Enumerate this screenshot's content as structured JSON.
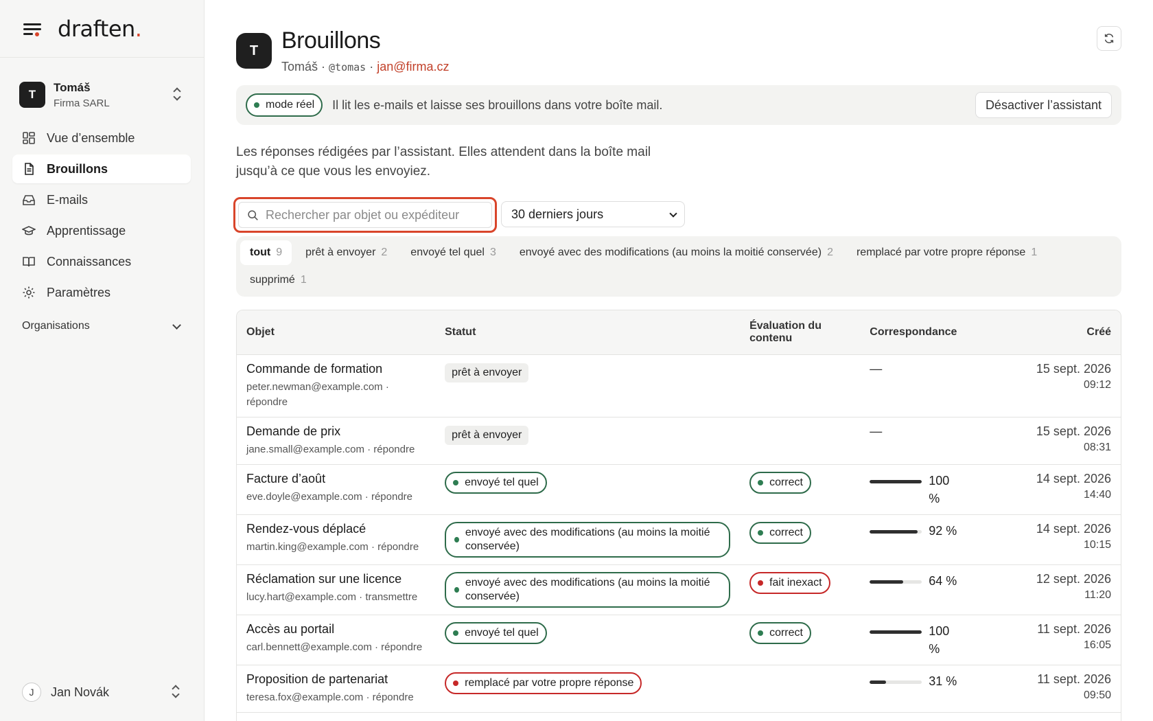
{
  "brand": {
    "logo_text": "draften",
    "logo_dot": "."
  },
  "org": {
    "avatar": "T",
    "name": "Tomáš",
    "company": "Firma SARL"
  },
  "nav": [
    {
      "label": "Vue d’ensemble",
      "icon": "grid-icon"
    },
    {
      "label": "Brouillons",
      "icon": "document-icon",
      "active": true
    },
    {
      "label": "E-mails",
      "icon": "inbox-icon"
    },
    {
      "label": "Apprentissage",
      "icon": "graduation-cap-icon"
    },
    {
      "label": "Connaissances",
      "icon": "book-icon"
    },
    {
      "label": "Paramètres",
      "icon": "gear-icon"
    }
  ],
  "organisations_label": "Organisations",
  "user": {
    "avatar": "J",
    "name": "Jan Novák"
  },
  "header": {
    "avatar": "T",
    "title": "Brouillons",
    "name": "Tomáš",
    "sep1": " · ",
    "handle": "@tomas",
    "sep2": " · ",
    "email": "jan@firma.cz"
  },
  "banner": {
    "mode_label": "mode réel",
    "text": "Il lit les e-mails et laisse ses brouillons dans votre boîte mail.",
    "deactivate_label": "Désactiver l’assistant"
  },
  "intro": "Les réponses rédigées par l’assistant. Elles attendent dans la boîte mail jusqu’à ce que vous les envoyiez.",
  "search": {
    "placeholder": "Rechercher par objet ou expéditeur",
    "value": ""
  },
  "period": {
    "selected": "30 derniers jours"
  },
  "tabs": [
    {
      "label": "tout",
      "count": "9",
      "active": true
    },
    {
      "label": "prêt à envoyer",
      "count": "2"
    },
    {
      "label": "envoyé tel quel",
      "count": "3"
    },
    {
      "label": "envoyé avec des modifications (au moins la moitié conservée)",
      "count": "2"
    },
    {
      "label": "remplacé par votre propre réponse",
      "count": "1"
    },
    {
      "label": "supprimé",
      "count": "1"
    }
  ],
  "table": {
    "headers": {
      "subject": "Objet",
      "status": "Statut",
      "evaluation": "Évaluation du contenu",
      "match": "Correspondance",
      "created": "Créé"
    },
    "rows": [
      {
        "subject": "Commande de formation",
        "from": "peter.newman@example.com · répondre",
        "status": "prêt à envoyer",
        "status_kind": "grey",
        "evaluation": "",
        "eval_kind": "",
        "match_text": "—",
        "match_value": null,
        "date": "15 sept. 2026",
        "time": "09:12"
      },
      {
        "subject": "Demande de prix",
        "from": "jane.small@example.com · répondre",
        "status": "prêt à envoyer",
        "status_kind": "grey",
        "evaluation": "",
        "eval_kind": "",
        "match_text": "—",
        "match_value": null,
        "date": "15 sept. 2026",
        "time": "08:31"
      },
      {
        "subject": "Facture d’août",
        "from": "eve.doyle@example.com · répondre",
        "status": "envoyé tel quel",
        "status_kind": "green",
        "evaluation": "correct",
        "eval_kind": "green",
        "match_text": "100 %",
        "match_value": 1.0,
        "date": "14 sept. 2026",
        "time": "14:40"
      },
      {
        "subject": "Rendez-vous déplacé",
        "from": "martin.king@example.com · répondre",
        "status": "envoyé avec des modifications (au moins la moitié conservée)",
        "status_kind": "green",
        "evaluation": "correct",
        "eval_kind": "green",
        "match_text": "92 %",
        "match_value": 0.92,
        "date": "14 sept. 2026",
        "time": "10:15"
      },
      {
        "subject": "Réclamation sur une licence",
        "from": "lucy.hart@example.com · transmettre",
        "status": "envoyé avec des modifications (au moins la moitié conservée)",
        "status_kind": "green",
        "evaluation": "fait inexact",
        "eval_kind": "red",
        "match_text": "64 %",
        "match_value": 0.64,
        "date": "12 sept. 2026",
        "time": "11:20"
      },
      {
        "subject": "Accès au portail",
        "from": "carl.bennett@example.com · répondre",
        "status": "envoyé tel quel",
        "status_kind": "green",
        "evaluation": "correct",
        "eval_kind": "green",
        "match_text": "100 %",
        "match_value": 1.0,
        "date": "11 sept. 2026",
        "time": "16:05"
      },
      {
        "subject": "Proposition de partenariat",
        "from": "teresa.fox@example.com · répondre",
        "status": "remplacé par votre propre réponse",
        "status_kind": "red",
        "evaluation": "",
        "eval_kind": "",
        "match_text": "31 %",
        "match_value": 0.31,
        "date": "11 sept. 2026",
        "time": "09:50"
      }
    ]
  },
  "colors": {
    "accent": "#d9452b",
    "green": "#2e6b4a",
    "red": "#c62828",
    "link": "#c2412a"
  }
}
